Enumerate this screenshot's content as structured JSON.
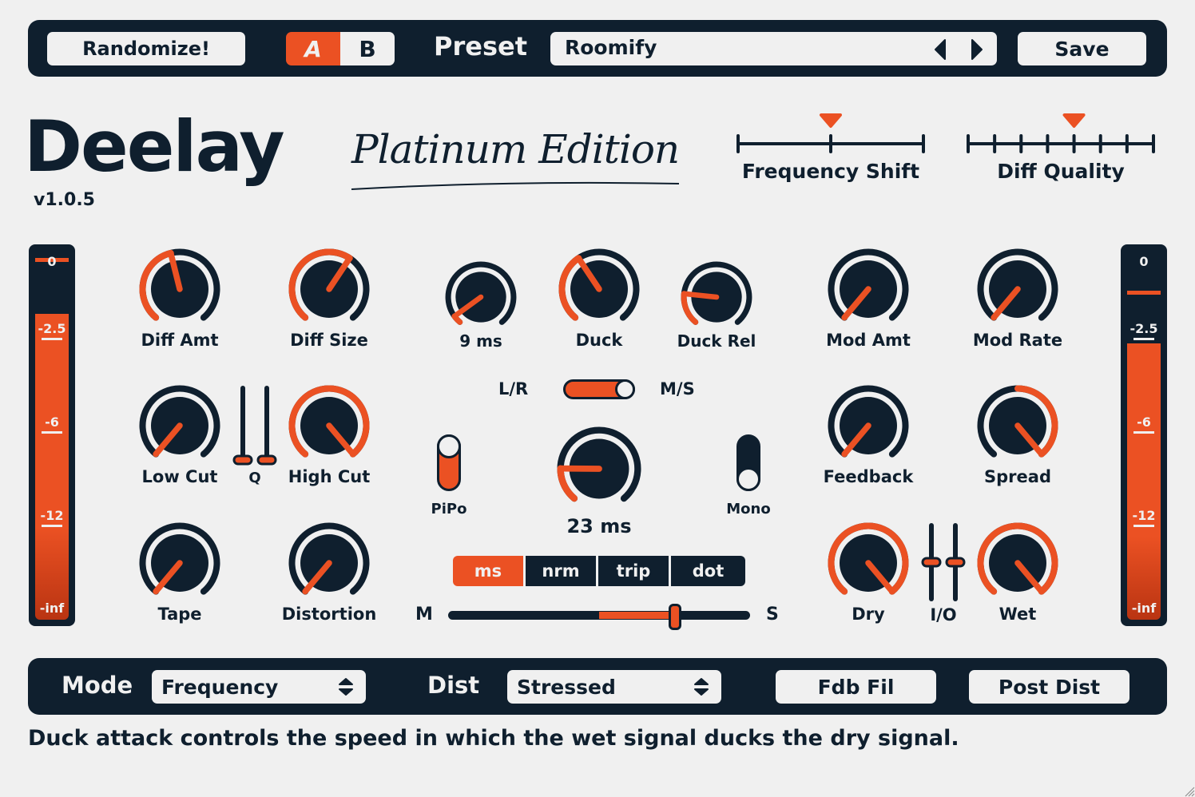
{
  "colors": {
    "accent": "#eb5123",
    "dark": "#0f1f2e",
    "background": "#f0f0f0"
  },
  "topbar": {
    "randomize_label": "Randomize!",
    "ab": {
      "a_label": "A",
      "b_label": "B",
      "active": "A"
    },
    "preset_label": "Preset",
    "preset_value": "Roomify",
    "prev_icon": "triangle-left-icon",
    "next_icon": "triangle-right-icon",
    "save_label": "Save"
  },
  "header": {
    "title": "Deelay",
    "version": "v1.0.5",
    "edition": "Platinum Edition"
  },
  "selectors": {
    "frequency_shift": {
      "label": "Frequency Shift",
      "steps": 3,
      "selected_index": 1
    },
    "diff_quality": {
      "label": "Diff Quality",
      "steps": 8,
      "selected_index": 4
    }
  },
  "meters": {
    "input": {
      "ticks": [
        "0",
        "-2.5",
        "-6",
        "-12",
        "-inf"
      ],
      "level": 0.83,
      "peak": 0.97
    },
    "output": {
      "ticks": [
        "0",
        "-2.5",
        "-6",
        "-12",
        "-inf"
      ],
      "level": 0.75,
      "peak": 0.88
    }
  },
  "knobs": {
    "diff_amt": {
      "label": "Diff Amt",
      "value": 0.45
    },
    "diff_size": {
      "label": "Diff Size",
      "value": 0.62
    },
    "low_cut": {
      "label": "Low Cut",
      "value": 0.0
    },
    "high_cut": {
      "label": "High Cut",
      "value": 1.0
    },
    "tape": {
      "label": "Tape",
      "value": 0.0
    },
    "distortion": {
      "label": "Distortion",
      "value": 0.0
    },
    "duck_attack": {
      "label": "9 ms",
      "value": 0.05
    },
    "duck": {
      "label": "Duck",
      "value": 0.38
    },
    "duck_rel": {
      "label": "Duck Rel",
      "value": 0.2
    },
    "delay_time": {
      "label": "23 ms",
      "value": 0.18
    },
    "mod_amt": {
      "label": "Mod Amt",
      "value": 0.0
    },
    "mod_rate": {
      "label": "Mod Rate",
      "value": 0.0
    },
    "feedback": {
      "label": "Feedback",
      "value": 0.0
    },
    "spread": {
      "label": "Spread",
      "value": 1.0,
      "bipolar": true
    },
    "dry": {
      "label": "Dry",
      "value": 1.0
    },
    "wet": {
      "label": "Wet",
      "value": 1.0
    }
  },
  "q_sliders": {
    "label": "Q",
    "values": [
      0.0,
      0.0
    ]
  },
  "io_sliders": {
    "label": "I/O",
    "values": [
      0.5,
      0.5
    ]
  },
  "stereo_toggle": {
    "left_label": "L/R",
    "right_label": "M/S",
    "state": "M/S"
  },
  "pipo": {
    "label": "PiPo",
    "on": true
  },
  "mono": {
    "label": "Mono",
    "on": false
  },
  "time_modes": {
    "options": [
      "ms",
      "nrm",
      "trip",
      "dot"
    ],
    "selected": "ms"
  },
  "ms_slider": {
    "left_label": "M",
    "right_label": "S",
    "value": 0.75
  },
  "bottombar": {
    "mode_label": "Mode",
    "mode_value": "Frequency",
    "dist_label": "Dist",
    "dist_value": "Stressed",
    "fdb_fil_label": "Fdb Fil",
    "post_dist_label": "Post Dist"
  },
  "tooltip": "Duck attack controls the speed in which the wet signal ducks the dry signal."
}
